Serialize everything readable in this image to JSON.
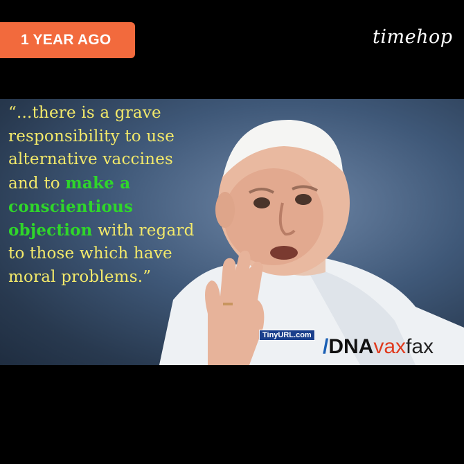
{
  "badge": {
    "label": "1 YEAR AGO",
    "color": "#f26a3d"
  },
  "logo": {
    "text": "timehop"
  },
  "quote": {
    "line1": "“...there is a grave",
    "line2": "responsibility to use",
    "line3": "alternative vaccines",
    "line4a": "and to ",
    "line4b": "make a",
    "line5": "conscientious",
    "line6a": "objection",
    "line6b": " with regard",
    "line7": "to those which have",
    "line8": "moral problems.”"
  },
  "watermark": {
    "tinyurl": "TinyURL.com",
    "slash": "/",
    "dna": "DNA",
    "vax": "vax",
    "fax": "fax"
  },
  "colors": {
    "quote_text": "#f3e96a",
    "quote_highlight": "#2fd62a",
    "background": "#000000"
  }
}
